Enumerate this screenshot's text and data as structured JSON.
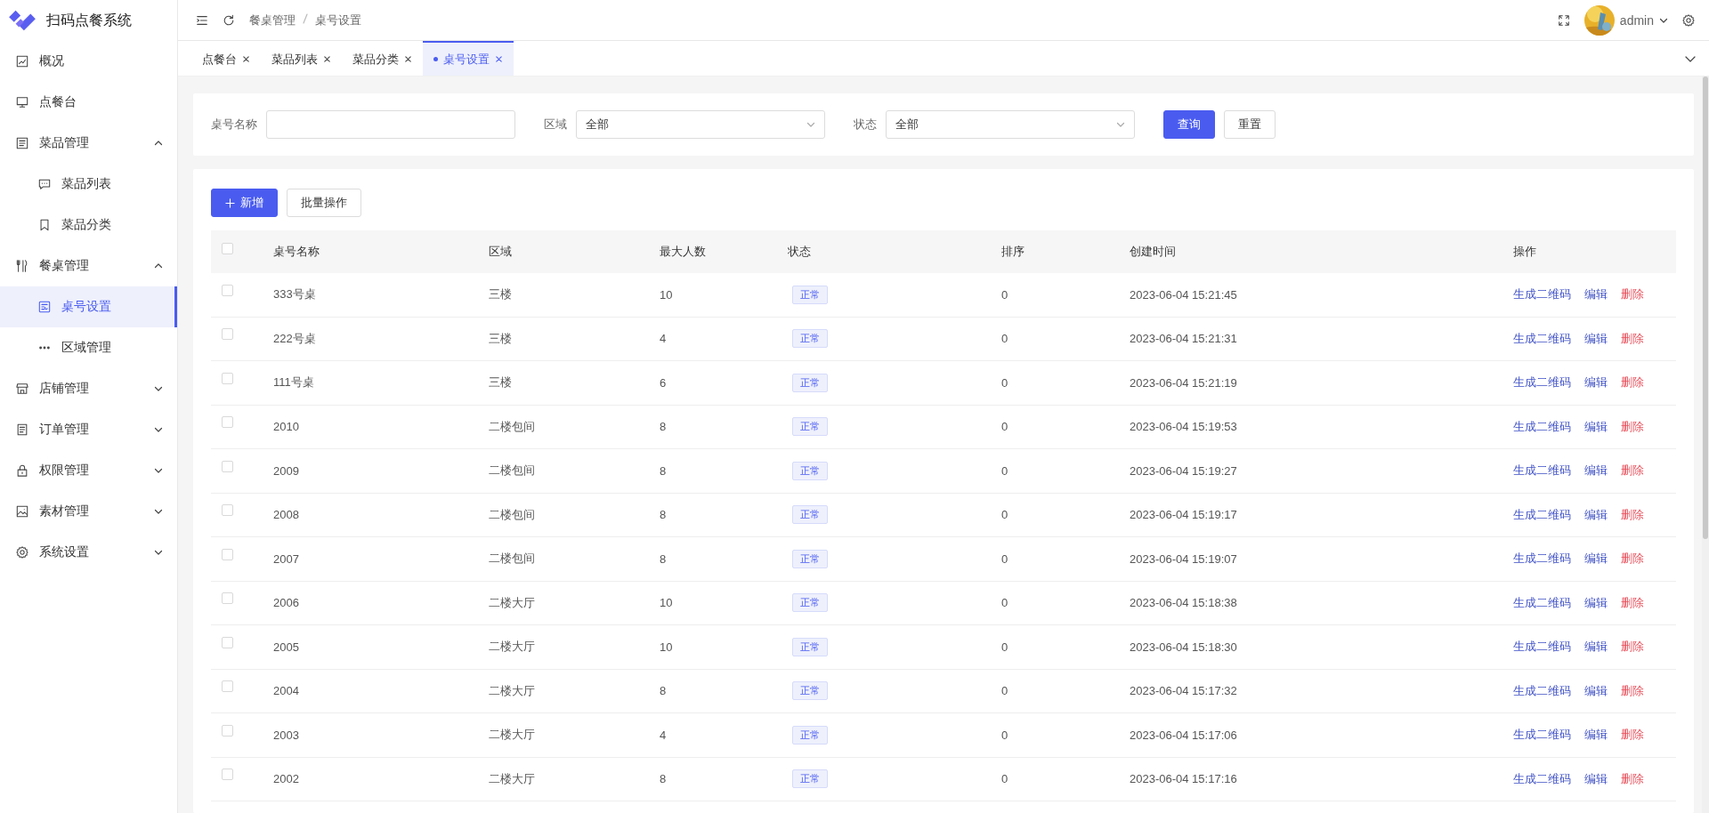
{
  "app": {
    "title": "扫码点餐系统"
  },
  "sidebar": {
    "items": [
      {
        "label": "概况",
        "selected": false
      },
      {
        "label": "点餐台",
        "selected": false
      },
      {
        "label": "菜品管理",
        "selected": false,
        "expanded": true,
        "children": [
          {
            "label": "菜品列表",
            "selected": false
          },
          {
            "label": "菜品分类",
            "selected": false
          }
        ]
      },
      {
        "label": "餐桌管理",
        "selected": false,
        "expanded": true,
        "children": [
          {
            "label": "桌号设置",
            "selected": true
          },
          {
            "label": "区域管理",
            "selected": false
          }
        ]
      },
      {
        "label": "店铺管理",
        "selected": false,
        "expanded": false
      },
      {
        "label": "订单管理",
        "selected": false,
        "expanded": false
      },
      {
        "label": "权限管理",
        "selected": false,
        "expanded": false
      },
      {
        "label": "素材管理",
        "selected": false,
        "expanded": false
      },
      {
        "label": "系统设置",
        "selected": false,
        "expanded": false
      }
    ]
  },
  "header": {
    "breadcrumb": [
      "餐桌管理",
      "桌号设置"
    ],
    "user": "admin"
  },
  "tabs": [
    {
      "label": "点餐台",
      "selected": false
    },
    {
      "label": "菜品列表",
      "selected": false
    },
    {
      "label": "菜品分类",
      "selected": false
    },
    {
      "label": "桌号设置",
      "selected": true
    }
  ],
  "filters": {
    "fields": [
      {
        "kind": "input",
        "label": "桌号名称"
      },
      {
        "kind": "select",
        "label": "区域",
        "value": "全部"
      },
      {
        "kind": "select",
        "label": "状态",
        "value": "全部"
      }
    ],
    "query": "查询",
    "reset": "重置"
  },
  "toolbar": {
    "add": "新增",
    "batch": "批量操作"
  },
  "table": {
    "checked": false,
    "columns": [
      "桌号名称",
      "区域",
      "最大人数",
      "状态",
      "排序",
      "创建时间",
      "操作"
    ],
    "rows": [
      {
        "checked": false,
        "name": "333号桌",
        "area": "三楼",
        "capacity": "10",
        "status": "正常",
        "sort": "0",
        "created": "2023-06-04 15:21:45",
        "actions": [
          {
            "label": "生成二维码",
            "kind": "link"
          },
          {
            "label": "编辑",
            "kind": "link"
          },
          {
            "label": "删除",
            "kind": "danger"
          }
        ]
      },
      {
        "checked": false,
        "name": "222号桌",
        "area": "三楼",
        "capacity": "4",
        "status": "正常",
        "sort": "0",
        "created": "2023-06-04 15:21:31",
        "actions": [
          {
            "label": "生成二维码",
            "kind": "link"
          },
          {
            "label": "编辑",
            "kind": "link"
          },
          {
            "label": "删除",
            "kind": "danger"
          }
        ]
      },
      {
        "checked": false,
        "name": "111号桌",
        "area": "三楼",
        "capacity": "6",
        "status": "正常",
        "sort": "0",
        "created": "2023-06-04 15:21:19",
        "actions": [
          {
            "label": "生成二维码",
            "kind": "link"
          },
          {
            "label": "编辑",
            "kind": "link"
          },
          {
            "label": "删除",
            "kind": "danger"
          }
        ]
      },
      {
        "checked": false,
        "name": "2010",
        "area": "二楼包间",
        "capacity": "8",
        "status": "正常",
        "sort": "0",
        "created": "2023-06-04 15:19:53",
        "actions": [
          {
            "label": "生成二维码",
            "kind": "link"
          },
          {
            "label": "编辑",
            "kind": "link"
          },
          {
            "label": "删除",
            "kind": "danger"
          }
        ]
      },
      {
        "checked": false,
        "name": "2009",
        "area": "二楼包间",
        "capacity": "8",
        "status": "正常",
        "sort": "0",
        "created": "2023-06-04 15:19:27",
        "actions": [
          {
            "label": "生成二维码",
            "kind": "link"
          },
          {
            "label": "编辑",
            "kind": "link"
          },
          {
            "label": "删除",
            "kind": "danger"
          }
        ]
      },
      {
        "checked": false,
        "name": "2008",
        "area": "二楼包间",
        "capacity": "8",
        "status": "正常",
        "sort": "0",
        "created": "2023-06-04 15:19:17",
        "actions": [
          {
            "label": "生成二维码",
            "kind": "link"
          },
          {
            "label": "编辑",
            "kind": "link"
          },
          {
            "label": "删除",
            "kind": "danger"
          }
        ]
      },
      {
        "checked": false,
        "name": "2007",
        "area": "二楼包间",
        "capacity": "8",
        "status": "正常",
        "sort": "0",
        "created": "2023-06-04 15:19:07",
        "actions": [
          {
            "label": "生成二维码",
            "kind": "link"
          },
          {
            "label": "编辑",
            "kind": "link"
          },
          {
            "label": "删除",
            "kind": "danger"
          }
        ]
      },
      {
        "checked": false,
        "name": "2006",
        "area": "二楼大厅",
        "capacity": "10",
        "status": "正常",
        "sort": "0",
        "created": "2023-06-04 15:18:38",
        "actions": [
          {
            "label": "生成二维码",
            "kind": "link"
          },
          {
            "label": "编辑",
            "kind": "link"
          },
          {
            "label": "删除",
            "kind": "danger"
          }
        ]
      },
      {
        "checked": false,
        "name": "2005",
        "area": "二楼大厅",
        "capacity": "10",
        "status": "正常",
        "sort": "0",
        "created": "2023-06-04 15:18:30",
        "actions": [
          {
            "label": "生成二维码",
            "kind": "link"
          },
          {
            "label": "编辑",
            "kind": "link"
          },
          {
            "label": "删除",
            "kind": "danger"
          }
        ]
      },
      {
        "checked": false,
        "name": "2004",
        "area": "二楼大厅",
        "capacity": "8",
        "status": "正常",
        "sort": "0",
        "created": "2023-06-04 15:17:32",
        "actions": [
          {
            "label": "生成二维码",
            "kind": "link"
          },
          {
            "label": "编辑",
            "kind": "link"
          },
          {
            "label": "删除",
            "kind": "danger"
          }
        ]
      },
      {
        "checked": false,
        "name": "2003",
        "area": "二楼大厅",
        "capacity": "4",
        "status": "正常",
        "sort": "0",
        "created": "2023-06-04 15:17:06",
        "actions": [
          {
            "label": "生成二维码",
            "kind": "link"
          },
          {
            "label": "编辑",
            "kind": "link"
          },
          {
            "label": "删除",
            "kind": "danger"
          }
        ]
      },
      {
        "checked": false,
        "name": "2002",
        "area": "二楼大厅",
        "capacity": "8",
        "status": "正常",
        "sort": "0",
        "created": "2023-06-04 15:17:16",
        "actions": [
          {
            "label": "生成二维码",
            "kind": "link"
          },
          {
            "label": "编辑",
            "kind": "link"
          },
          {
            "label": "删除",
            "kind": "danger"
          }
        ]
      }
    ]
  }
}
